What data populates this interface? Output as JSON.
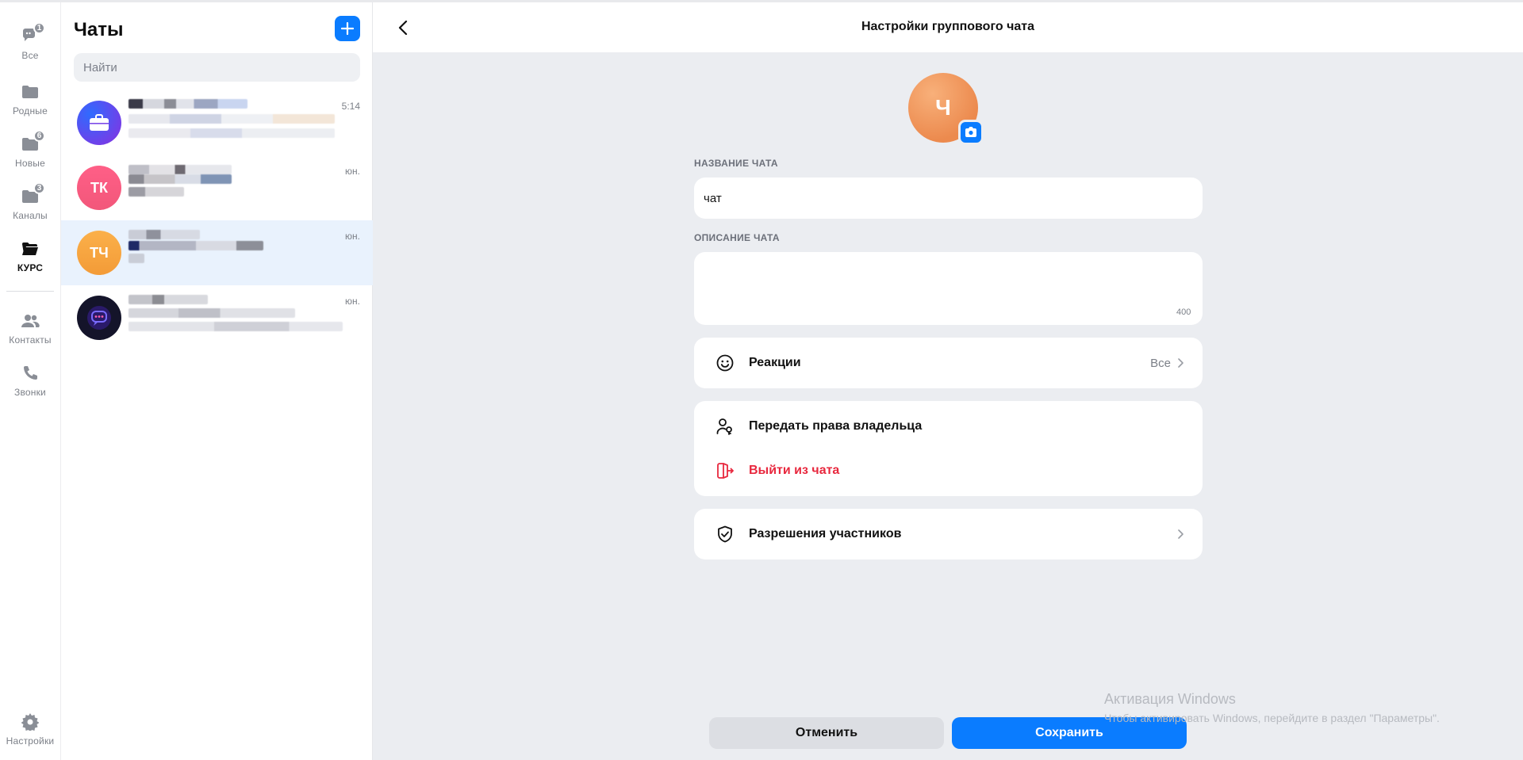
{
  "rail": {
    "items": [
      {
        "label": "Все",
        "badge": "1",
        "icon": "chat-bubbles-icon"
      },
      {
        "label": "Родные",
        "badge": "",
        "icon": "folder-icon"
      },
      {
        "label": "Новые",
        "badge": "6",
        "icon": "folder-icon"
      },
      {
        "label": "Каналы",
        "badge": "3",
        "icon": "folder-icon"
      },
      {
        "label": "КУРС",
        "badge": "",
        "icon": "folder-open-icon"
      },
      {
        "label": "Контакты",
        "badge": "",
        "icon": "people-icon"
      },
      {
        "label": "Звонки",
        "badge": "",
        "icon": "phone-icon"
      },
      {
        "label": "Настройки",
        "badge": "",
        "icon": "gear-icon"
      }
    ]
  },
  "chatlist": {
    "title": "Чаты",
    "search_placeholder": "Найти",
    "chats": [
      {
        "initials": "",
        "time": "5:14",
        "avatar_color": "#6c3ce0",
        "icon": "briefcase-icon"
      },
      {
        "initials": "ТК",
        "time": "юн.",
        "avatar_color": "#f44e7a"
      },
      {
        "initials": "ТЧ",
        "time": "юн.",
        "avatar_color": "#f6a340"
      },
      {
        "initials": "",
        "time": "юн.",
        "avatar_color": "#14142a",
        "icon": "chat-logo-icon"
      }
    ]
  },
  "settings": {
    "header_title": "Настройки группового чата",
    "avatar_letter": "Ч",
    "name_label": "НАЗВАНИЕ ЧАТА",
    "name_value": "чат",
    "description_label": "ОПИСАНИЕ ЧАТА",
    "description_value": "",
    "description_counter": "400",
    "reactions_label": "Реакции",
    "reactions_value": "Все",
    "transfer_owner_label": "Передать права владельца",
    "leave_chat_label": "Выйти из чата",
    "permissions_label": "Разрешения участников",
    "cancel_label": "Отменить",
    "save_label": "Сохранить"
  },
  "watermark": {
    "title": "Активация Windows",
    "subtitle": "Чтобы активировать Windows, перейдите в раздел \"Параметры\"."
  },
  "colors": {
    "accent": "#0a7cff",
    "danger": "#e8283e",
    "avatar_orange": "#ec8a4e"
  }
}
